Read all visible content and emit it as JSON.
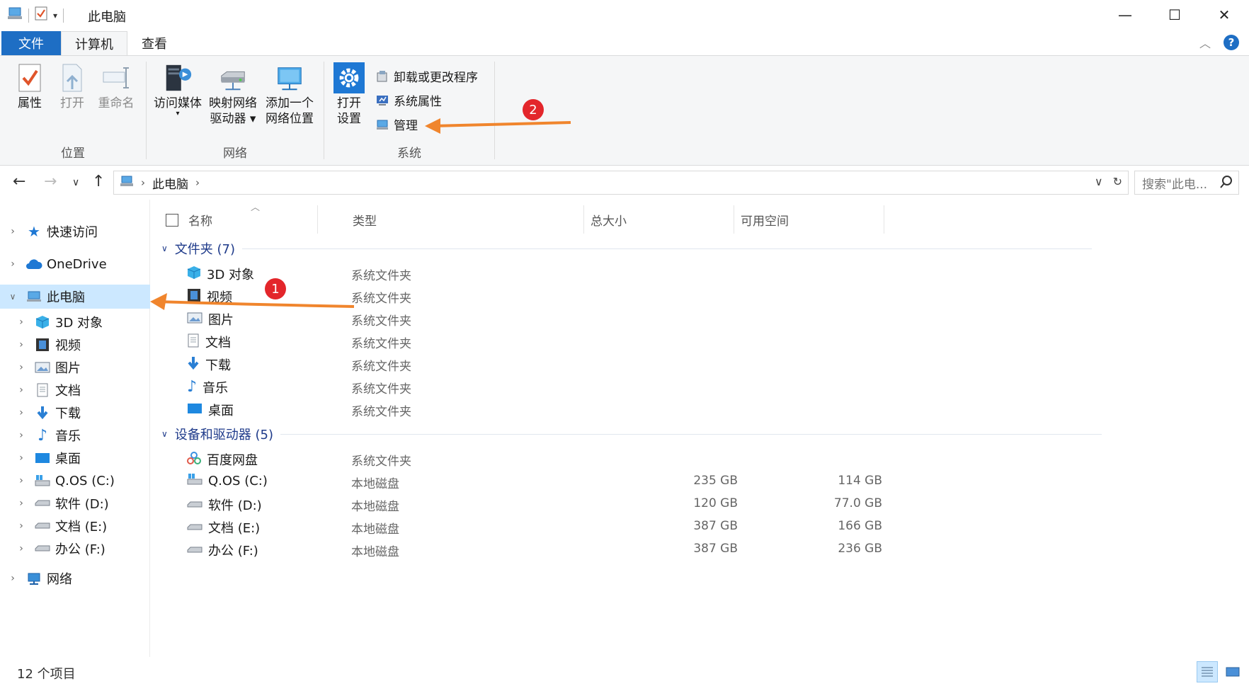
{
  "window": {
    "title": "此电脑",
    "minimize": "—",
    "maximize": "☐",
    "close": "✕"
  },
  "tabs": {
    "file": "文件",
    "computer": "计算机",
    "view": "查看"
  },
  "ribbon": {
    "location": {
      "label": "位置",
      "properties": "属性",
      "open": "打开",
      "rename": "重命名"
    },
    "network": {
      "label": "网络",
      "access_media": "访问媒体",
      "map_drive_l1": "映射网络",
      "map_drive_l2": "驱动器",
      "add_location_l1": "添加一个",
      "add_location_l2": "网络位置"
    },
    "system": {
      "label": "系统",
      "open_settings_l1": "打开",
      "open_settings_l2": "设置",
      "uninstall": "卸载或更改程序",
      "sys_props": "系统属性",
      "manage": "管理"
    }
  },
  "address": {
    "crumb": "此电脑",
    "search_placeholder": "搜索\"此电..."
  },
  "nav": {
    "quick_access": "快速访问",
    "onedrive": "OneDrive",
    "this_pc": "此电脑",
    "children": [
      "3D 对象",
      "视频",
      "图片",
      "文档",
      "下载",
      "音乐",
      "桌面",
      "Q.OS (C:)",
      "软件 (D:)",
      "文档 (E:)",
      "办公 (F:)"
    ],
    "network": "网络"
  },
  "columns": {
    "name": "名称",
    "type": "类型",
    "total": "总大小",
    "free": "可用空间"
  },
  "groups": {
    "folders": "文件夹 (7)",
    "devices": "设备和驱动器 (5)"
  },
  "folders": [
    {
      "name": "3D 对象",
      "type": "系统文件夹",
      "icon": "cube-icon"
    },
    {
      "name": "视频",
      "type": "系统文件夹",
      "icon": "video-icon"
    },
    {
      "name": "图片",
      "type": "系统文件夹",
      "icon": "picture-icon"
    },
    {
      "name": "文档",
      "type": "系统文件夹",
      "icon": "document-icon"
    },
    {
      "name": "下载",
      "type": "系统文件夹",
      "icon": "download-icon"
    },
    {
      "name": "音乐",
      "type": "系统文件夹",
      "icon": "music-icon"
    },
    {
      "name": "桌面",
      "type": "系统文件夹",
      "icon": "desktop-icon"
    }
  ],
  "drives": [
    {
      "name": "百度网盘",
      "type": "系统文件夹",
      "total": "",
      "free": "",
      "icon": "baidu-netdisk-icon"
    },
    {
      "name": "Q.OS (C:)",
      "type": "本地磁盘",
      "total": "235 GB",
      "free": "114 GB",
      "icon": "windows-drive-icon"
    },
    {
      "name": "软件 (D:)",
      "type": "本地磁盘",
      "total": "120 GB",
      "free": "77.0 GB",
      "icon": "drive-icon"
    },
    {
      "name": "文档 (E:)",
      "type": "本地磁盘",
      "total": "387 GB",
      "free": "166 GB",
      "icon": "drive-icon"
    },
    {
      "name": "办公 (F:)",
      "type": "本地磁盘",
      "total": "387 GB",
      "free": "236 GB",
      "icon": "drive-icon"
    }
  ],
  "status": {
    "count": "12 个项目"
  },
  "annotations": {
    "badge1": "1",
    "badge2": "2",
    "color": "#f0852d"
  },
  "colors": {
    "accent": "#1e6ec4",
    "selection": "#cce8ff"
  }
}
